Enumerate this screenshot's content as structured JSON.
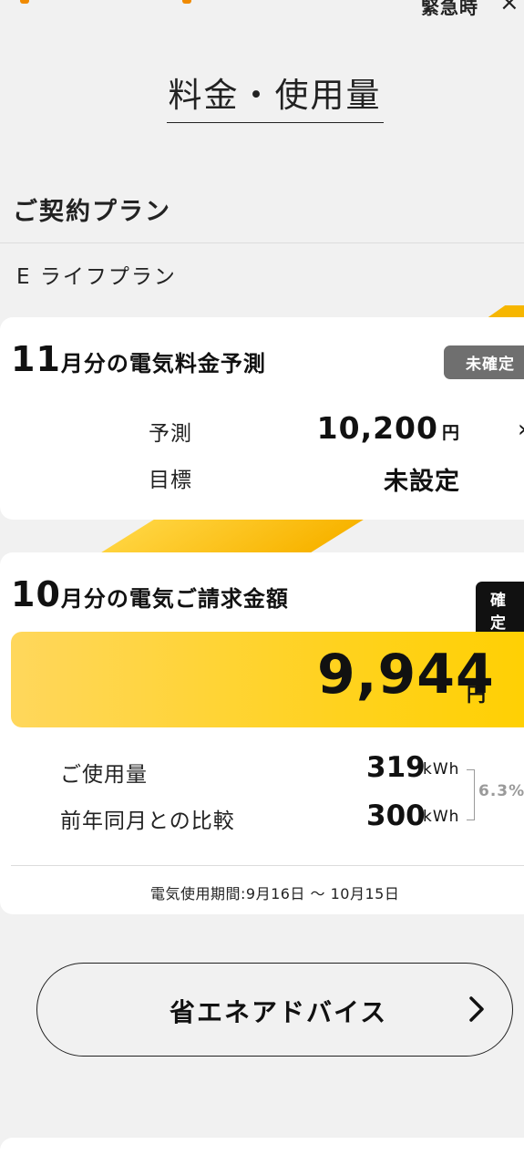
{
  "header": {
    "emergency_label": "緊急時",
    "close_glyph": "×"
  },
  "page_title": "料金・使用量",
  "plan": {
    "heading": "ご契約プラン",
    "name": "E ライフプラン"
  },
  "forecast_card": {
    "month": "11",
    "title_rest": "月分の電気料金予測",
    "badge": "未確定",
    "forecast_label": "予測",
    "forecast_amount": "10,200",
    "forecast_unit": "円",
    "target_label": "目標",
    "target_value": "未設定",
    "chevron": "›"
  },
  "bill_card": {
    "month": "10",
    "title_rest": "月分の電気ご請求金額",
    "badge": "確定",
    "amount": "9,944",
    "amount_unit": "円",
    "usage_label": "ご使用量",
    "usage_value": "319",
    "usage_unit": "kWh",
    "compare_label": "前年同月との比較",
    "compare_value": "300",
    "compare_unit": "kWh",
    "ratio": "6.3%",
    "period": "電気使用期間:9月16日 〜 10月15日"
  },
  "advice_button": {
    "label": "省エネアドバイス"
  },
  "colors": {
    "brand_yellow": "#ffd21f",
    "badge_gray": "#6f6f6f",
    "badge_black": "#111111",
    "logo_orange": "#f08a00"
  },
  "icons": [
    "close-icon",
    "chevron-right-icon"
  ]
}
